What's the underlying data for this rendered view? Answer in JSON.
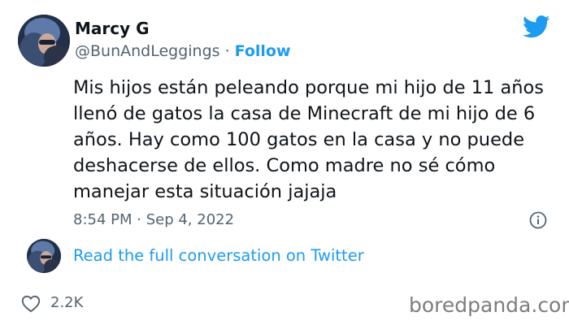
{
  "author": {
    "name": "Marcy G",
    "handle": "@BunAndLeggings",
    "separator": "·",
    "follow_label": "Follow"
  },
  "tweet": {
    "text": "Mis hijos están peleando porque mi hijo de 11 años llenó de gatos la casa de Minecraft de mi hijo de 6 años. Hay como 100 gatos en la casa y no puede deshacerse de ellos. Como madre no sé cómo manejar esta situación jajaja",
    "timestamp": "8:54 PM · Sep 4, 2022"
  },
  "conversation": {
    "link_label": "Read the full conversation on Twitter"
  },
  "engagement": {
    "likes": "2.2K"
  },
  "icons": {
    "brand": "twitter-bird-icon",
    "info": "info-icon",
    "like": "heart-icon"
  },
  "colors": {
    "accent": "#1d9bf0",
    "text": "#0f1419",
    "muted": "#536471"
  },
  "watermark": "boredpanda.com"
}
